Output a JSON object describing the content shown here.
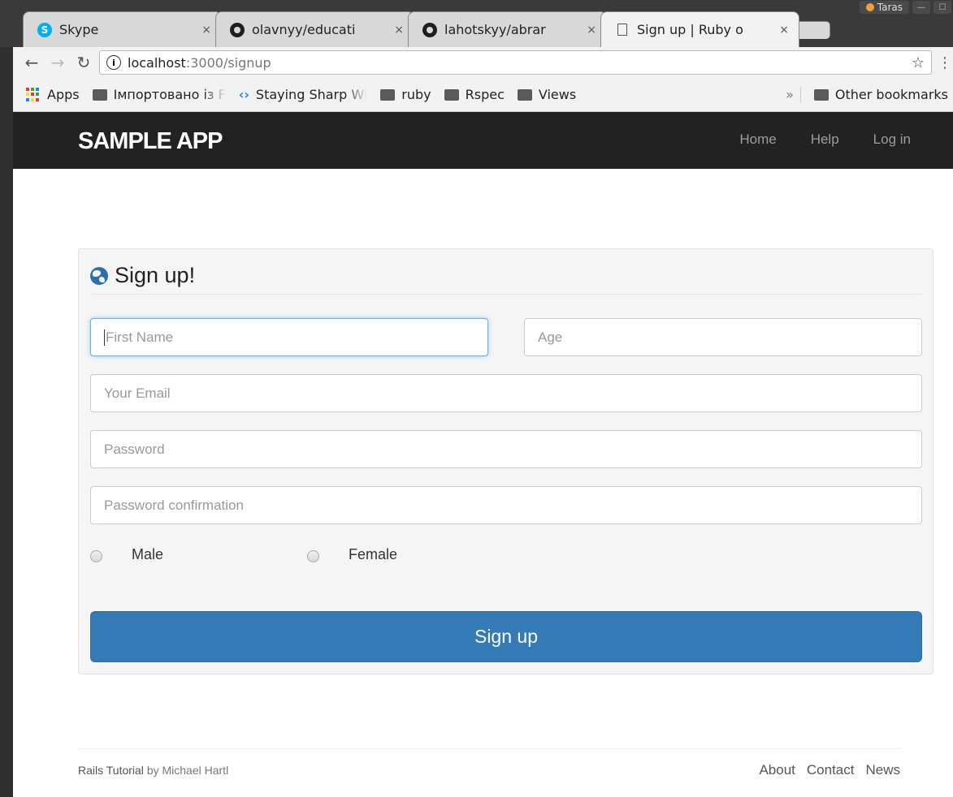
{
  "browser": {
    "profile_name": "Taras",
    "tabs": [
      {
        "title": "Skype",
        "icon": "skype-icon",
        "active": false
      },
      {
        "title": "olavnyy/educati",
        "icon": "github-icon",
        "active": false
      },
      {
        "title": "lahotskyy/abrar",
        "icon": "github-icon",
        "active": false
      },
      {
        "title": "Sign up | Ruby o",
        "icon": "page-icon",
        "active": true
      }
    ],
    "close_glyph": "×",
    "url_host": "localhost",
    "url_path": ":3000/signup",
    "bookmarks": {
      "apps": "Apps",
      "imported": "Імпортовано із F",
      "staying_sharp": "Staying Sharp Wi",
      "ruby": "ruby",
      "rspec": "Rspec",
      "views": "Views",
      "more": "»",
      "other": "Other bookmarks"
    }
  },
  "navbar": {
    "brand": "SAMPLE APP",
    "links": [
      "Home",
      "Help",
      "Log in"
    ]
  },
  "form": {
    "title": "Sign up!",
    "first_name_placeholder": "First Name",
    "age_placeholder": "Age",
    "email_placeholder": "Your Email",
    "password_placeholder": "Password",
    "password_confirmation_placeholder": "Password confirmation",
    "gender_options": [
      "Male",
      "Female"
    ],
    "submit_label": "Sign up"
  },
  "footer": {
    "tutorial": "Rails Tutorial",
    "by": "by Michael Hartl",
    "links": [
      "About",
      "Contact",
      "News"
    ]
  },
  "colors": {
    "navbar_bg": "#222222",
    "nav_link": "#9d9d9d",
    "primary_button": "#337ab7",
    "focus_border": "#66afe9"
  }
}
